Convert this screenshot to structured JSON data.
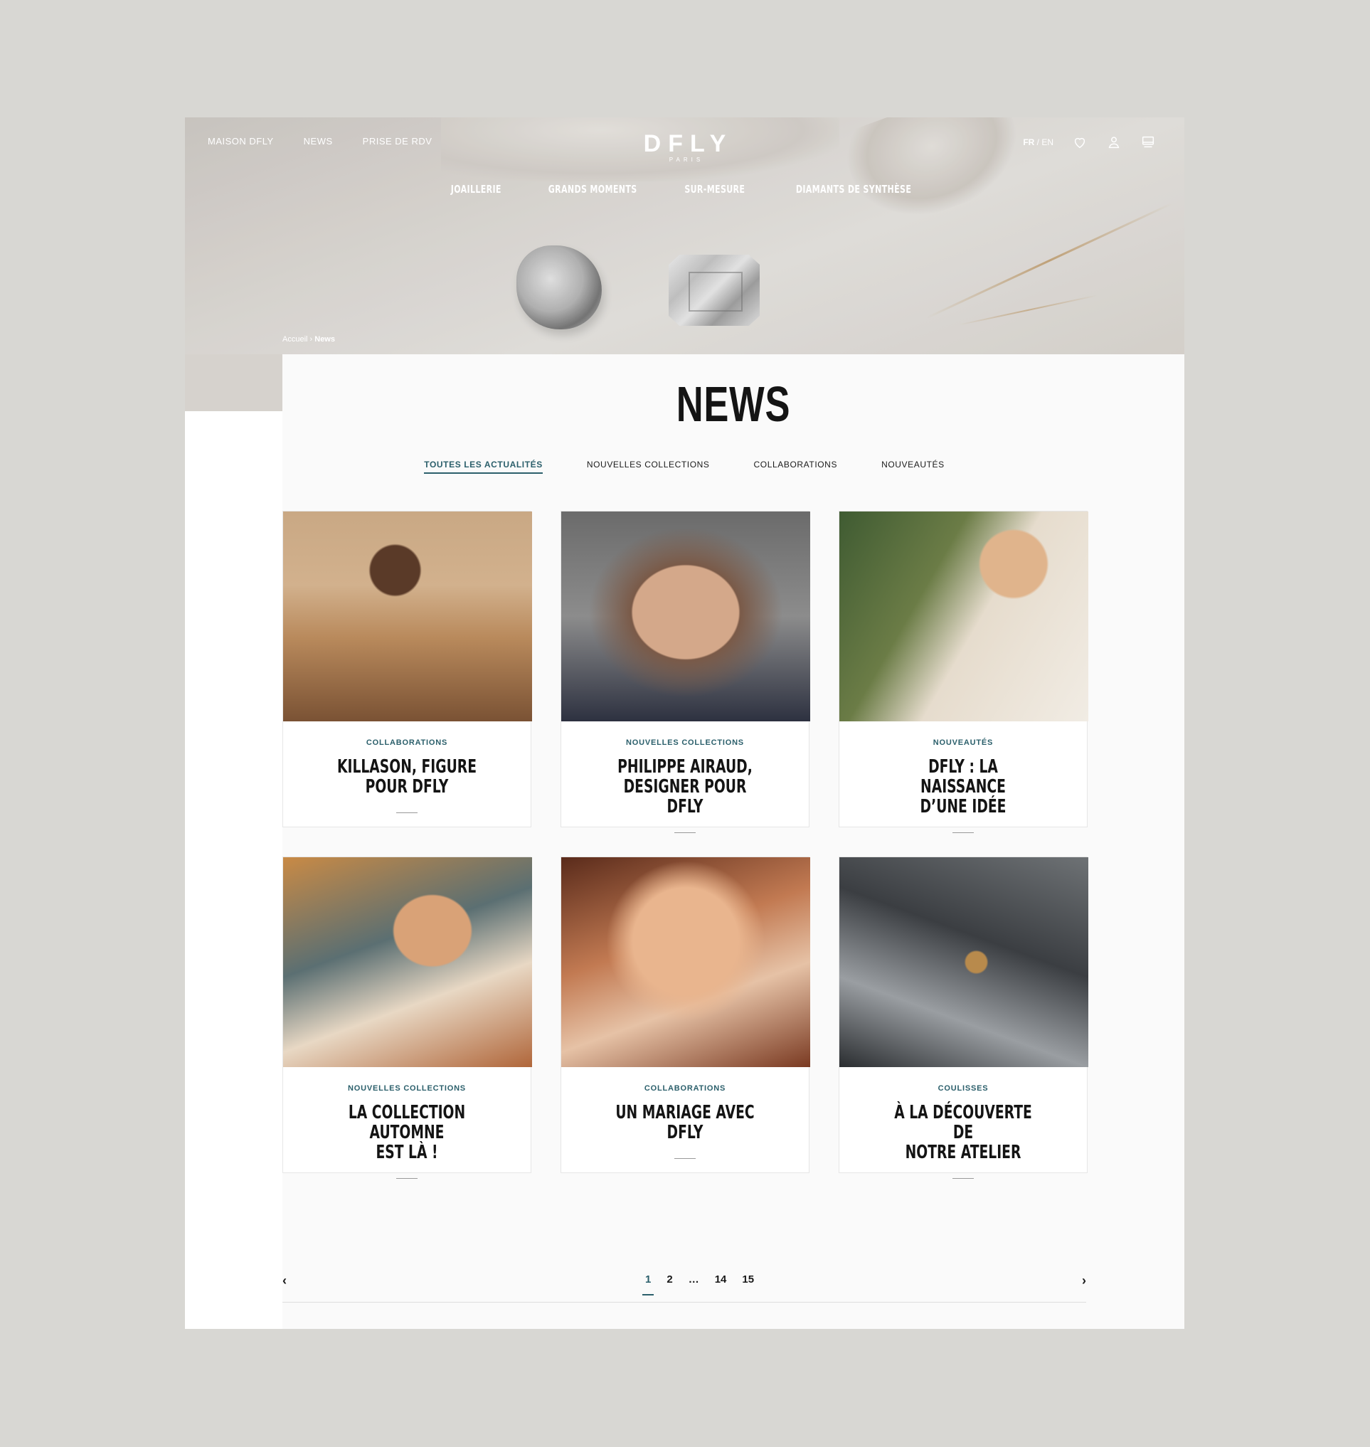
{
  "header": {
    "top_links": [
      "MAISON DFLY",
      "NEWS",
      "PRISE DE RDV"
    ],
    "logo": "DFLY",
    "logo_sub": "PARIS",
    "lang_active": "FR",
    "lang_sep": " / ",
    "lang_other": "EN",
    "main_nav": [
      "JOAILLERIE",
      "GRANDS MOMENTS",
      "SUR-MESURE",
      "DIAMANTS DE SYNTHÈSE"
    ]
  },
  "breadcrumb": {
    "home": "Accueil",
    "sep": " › ",
    "current": "News"
  },
  "page_title": "NEWS",
  "filters": [
    "TOUTES LES ACTUALITÉS",
    "NOUVELLES COLLECTIONS",
    "COLLABORATIONS",
    "NOUVEAUTÉS"
  ],
  "cards": [
    {
      "category": "COLLABORATIONS",
      "title_l1": "KILLASON, FIGURE",
      "title_l2": "POUR DFLY"
    },
    {
      "category": "NOUVELLES COLLECTIONS",
      "title_l1": "PHILIPPE AIRAUD,",
      "title_l2": "DESIGNER POUR DFLY"
    },
    {
      "category": "NOUVEAUTÉS",
      "title_l1": "DFLY : LA NAISSANCE",
      "title_l2": "D’UNE IDÉE"
    },
    {
      "category": "NOUVELLES COLLECTIONS",
      "title_l1": "LA COLLECTION AUTOMNE",
      "title_l2": "EST LÀ !"
    },
    {
      "category": "COLLABORATIONS",
      "title_l1": "UN MARIAGE AVEC",
      "title_l2": "DFLY"
    },
    {
      "category": "COULISSES",
      "title_l1": "À LA DÉCOUVERTE DE",
      "title_l2": "NOTRE ATELIER"
    }
  ],
  "pagination": {
    "prev": "‹",
    "next": "›",
    "pages": [
      "1",
      "2",
      "…",
      "14",
      "15"
    ],
    "active": "1"
  },
  "colors": {
    "accent": "#2b5f6b",
    "background": "#d8d7d3"
  }
}
